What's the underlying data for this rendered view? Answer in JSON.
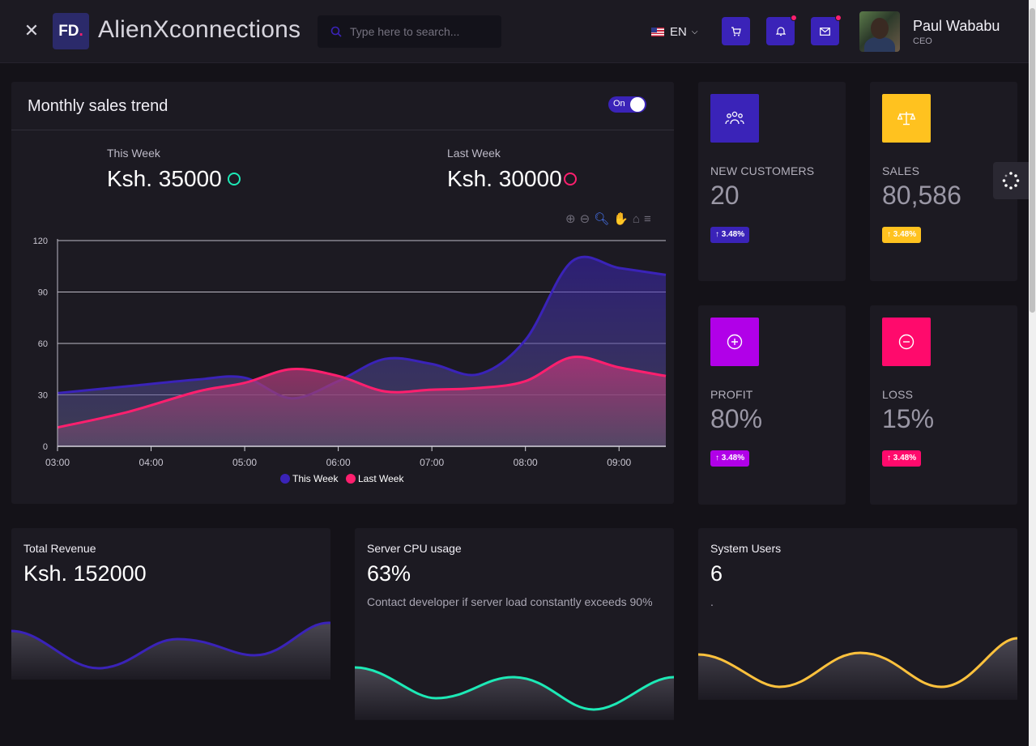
{
  "header": {
    "logo_text": "FD",
    "logo_dot": ".",
    "app_title": "AlienXconnections",
    "search_placeholder": "Type here to search...",
    "language": "EN",
    "user": {
      "name": "Paul Wababu",
      "role": "CEO"
    }
  },
  "sales": {
    "title": "Monthly sales trend",
    "toggle_label": "On",
    "this_week": {
      "label": "This Week",
      "value": "Ksh. 35000"
    },
    "last_week": {
      "label": "Last Week",
      "value": "Ksh. 30000"
    }
  },
  "chart_data": {
    "type": "area",
    "categories": [
      "03:00",
      "04:00",
      "05:00",
      "06:00",
      "07:00",
      "08:00",
      "09:00"
    ],
    "x_range": [
      "03:00",
      "09:30"
    ],
    "ylim": [
      0,
      120
    ],
    "yticks": [
      0,
      30,
      60,
      90,
      120
    ],
    "series": [
      {
        "name": "This Week",
        "color": "#3a23b8",
        "x": [
          0,
          0.75,
          1.5,
          2,
          2.5,
          3,
          3.5,
          4,
          4.5,
          5,
          5.5,
          6,
          6.5
        ],
        "values": [
          31,
          35,
          39,
          40,
          28,
          38,
          51,
          48,
          42,
          62,
          108,
          104,
          100
        ]
      },
      {
        "name": "Last Week",
        "color": "#ff1f6e",
        "x": [
          0,
          0.75,
          1.5,
          2,
          2.5,
          3,
          3.5,
          4,
          4.5,
          5,
          5.5,
          6,
          6.5
        ],
        "values": [
          11,
          20,
          32,
          37,
          45,
          41,
          32,
          33,
          34,
          38,
          52,
          46,
          41
        ]
      }
    ],
    "legend_position": "bottom"
  },
  "stats": [
    {
      "label": "NEW CUSTOMERS",
      "value": "20",
      "badge": "3.48%",
      "color": "#3a23b8",
      "icon": "users-icon"
    },
    {
      "label": "SALES",
      "value": "80,586",
      "badge": "3.48%",
      "color": "#ffc21f",
      "icon": "scale-icon"
    },
    {
      "label": "PROFIT",
      "value": "80%",
      "badge": "3.48%",
      "color": "#b100e8",
      "icon": "plus-circle-icon"
    },
    {
      "label": "LOSS",
      "value": "15%",
      "badge": "3.48%",
      "color": "#ff0a6c",
      "icon": "minus-circle-icon"
    }
  ],
  "mini_cards": [
    {
      "title": "Total Revenue",
      "value": "Ksh. 152000",
      "color": "#3a23b8"
    },
    {
      "title": "Server CPU usage",
      "value": "63%",
      "description": "Contact developer if server load constantly exceeds 90%",
      "color": "#1de9b6"
    },
    {
      "title": "System Users",
      "value": "6",
      "description": ".",
      "color": "#ffc23d"
    }
  ]
}
